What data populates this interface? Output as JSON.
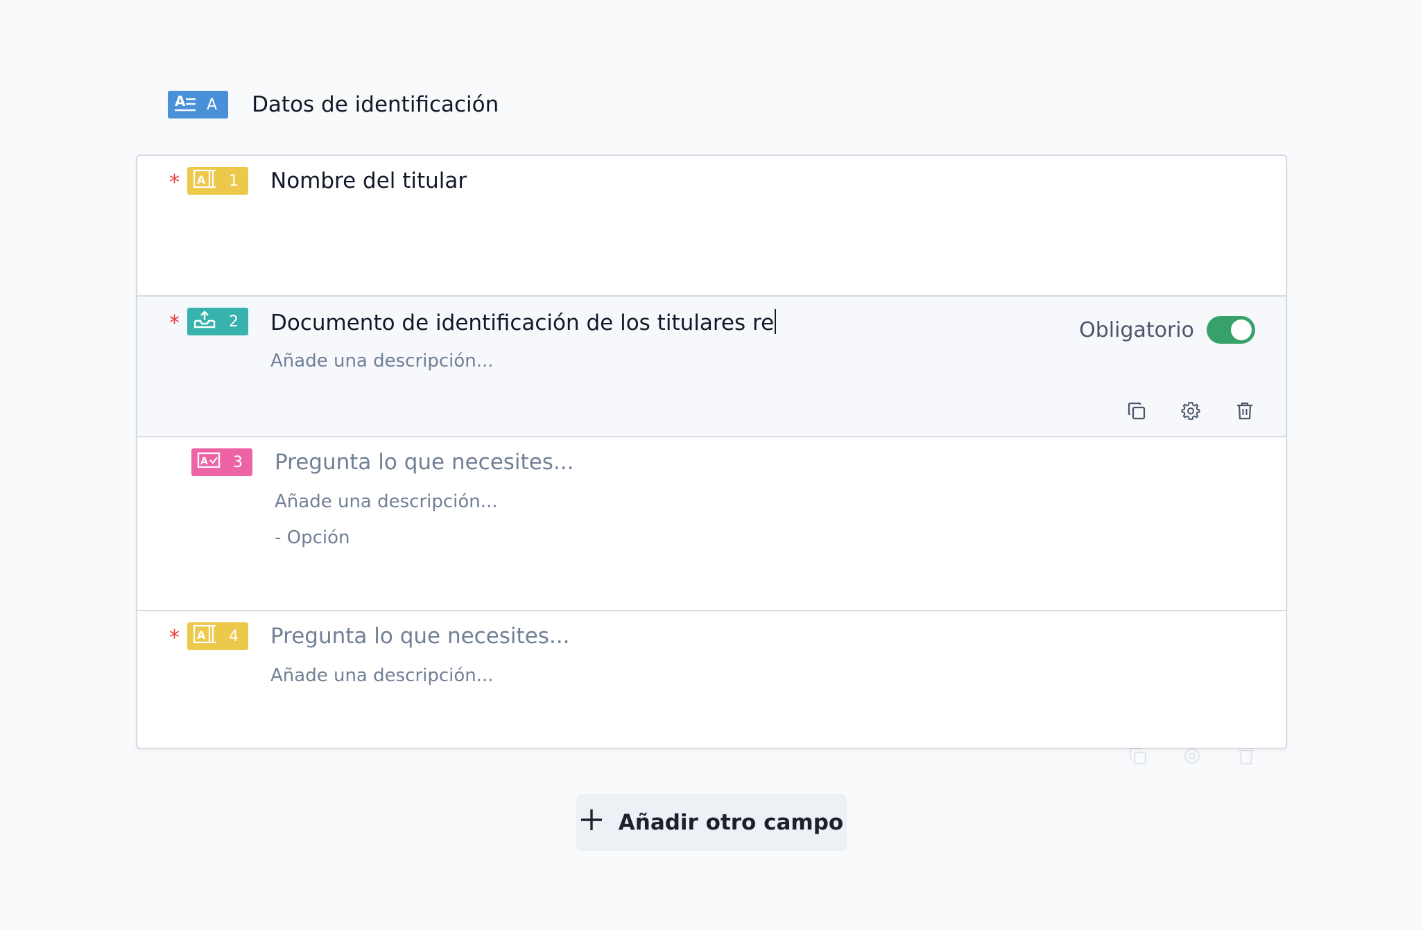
{
  "section": {
    "badge_letter": "A",
    "title": "Datos de identificación",
    "icon": "text-format-icon",
    "badge_color": "#4a90d9"
  },
  "fields": [
    {
      "number": "1",
      "required": true,
      "type_icon": "short-text-icon",
      "badge_color": "#ecc94b",
      "question": "Nombre del titular"
    },
    {
      "number": "2",
      "required": true,
      "type_icon": "file-upload-icon",
      "badge_color": "#38b2ac",
      "question": "Documento de identificación de los titulares re",
      "description_placeholder": "Añade una descripción...",
      "required_label": "Obligatorio",
      "required_on": true,
      "actions": [
        "duplicate-icon",
        "settings-icon",
        "delete-icon"
      ]
    },
    {
      "number": "3",
      "required": false,
      "type_icon": "multiple-choice-icon",
      "badge_color": "#ed64a6",
      "question_placeholder": "Pregunta lo que necesites...",
      "description_placeholder": "Añade una descripción...",
      "option_placeholder": "- Opción"
    },
    {
      "number": "4",
      "required": true,
      "type_icon": "short-text-icon",
      "badge_color": "#ecc94b",
      "question_placeholder": "Pregunta lo que necesites...",
      "description_placeholder": "Añade una descripción..."
    }
  ],
  "required_marker": "*",
  "add_button": {
    "label": "Añadir otro campo",
    "icon": "plus-icon"
  }
}
